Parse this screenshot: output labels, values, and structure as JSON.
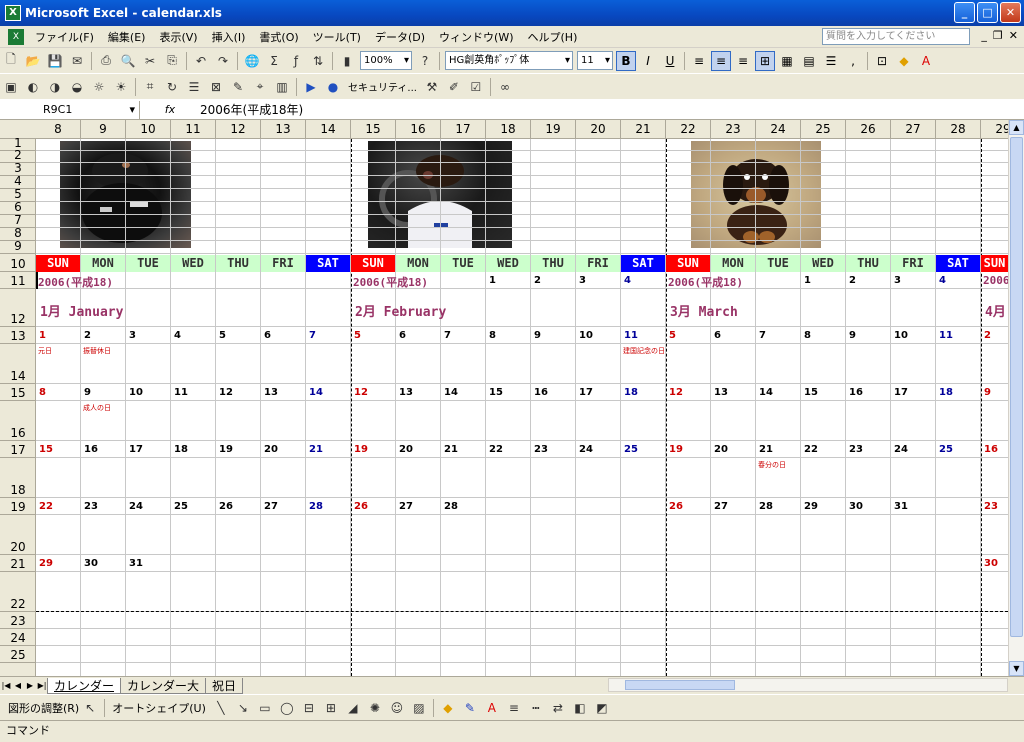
{
  "window": {
    "title": "Microsoft Excel - calendar.xls"
  },
  "menu": {
    "items": [
      "ファイル(F)",
      "編集(E)",
      "表示(V)",
      "挿入(I)",
      "書式(O)",
      "ツール(T)",
      "データ(D)",
      "ウィンドウ(W)",
      "ヘルプ(H)"
    ],
    "help_placeholder": "質問を入力してください"
  },
  "toolbar": {
    "zoom": "100%",
    "font": "HG創英角ﾎﾟｯﾌﾟ体",
    "size": "11",
    "security": "セキュリティ..."
  },
  "formula": {
    "cell": "R9C1",
    "fx": "fx",
    "value": "2006年(平成18年)"
  },
  "columns": [
    "8",
    "9",
    "10",
    "11",
    "12",
    "13",
    "14",
    "15",
    "16",
    "17",
    "18",
    "19",
    "20",
    "21",
    "22",
    "23",
    "24",
    "25",
    "26",
    "27",
    "28",
    "29"
  ],
  "rows": [
    "1",
    "2",
    "3",
    "4",
    "5",
    "6",
    "7",
    "8",
    "9",
    "10",
    "11",
    "12",
    "13",
    "14",
    "15",
    "16",
    "17",
    "18",
    "19",
    "20",
    "21",
    "22",
    "23",
    "24",
    "25"
  ],
  "dow": [
    "SUN",
    "MON",
    "TUE",
    "WED",
    "THU",
    "FRI",
    "SAT"
  ],
  "months": [
    {
      "year": "2006(平成18)",
      "title": "1月 January",
      "lead": [],
      "weeks": [
        [
          "1",
          "2",
          "3",
          "4",
          "5",
          "6",
          "7"
        ],
        [
          "8",
          "9",
          "10",
          "11",
          "12",
          "13",
          "14"
        ],
        [
          "15",
          "16",
          "17",
          "18",
          "19",
          "20",
          "21"
        ],
        [
          "22",
          "23",
          "24",
          "25",
          "26",
          "27",
          "28"
        ],
        [
          "29",
          "30",
          "31",
          "",
          "",
          "",
          ""
        ]
      ],
      "holidays": [
        {
          "w": 0,
          "d": 0,
          "t": "元日"
        },
        {
          "w": 0,
          "d": 1,
          "t": "振替休日"
        },
        {
          "w": 1,
          "d": 1,
          "t": "成人の日"
        }
      ]
    },
    {
      "year": "2006(平成18)",
      "title": "2月 February",
      "lead": [
        "",
        "",
        "",
        "1",
        "2",
        "3",
        "4"
      ],
      "weeks": [
        [
          "5",
          "6",
          "7",
          "8",
          "9",
          "10",
          "11"
        ],
        [
          "12",
          "13",
          "14",
          "15",
          "16",
          "17",
          "18"
        ],
        [
          "19",
          "20",
          "21",
          "22",
          "23",
          "24",
          "25"
        ],
        [
          "26",
          "27",
          "28",
          "",
          "",
          "",
          ""
        ],
        [
          "",
          "",
          "",
          "",
          "",
          "",
          ""
        ]
      ],
      "holidays": [
        {
          "w": 0,
          "d": 6,
          "t": "建国記念の日"
        }
      ]
    },
    {
      "year": "2006(平成18)",
      "title": "3月 March",
      "lead": [
        "",
        "",
        "",
        "1",
        "2",
        "3",
        "4"
      ],
      "weeks": [
        [
          "5",
          "6",
          "7",
          "8",
          "9",
          "10",
          "11"
        ],
        [
          "12",
          "13",
          "14",
          "15",
          "16",
          "17",
          "18"
        ],
        [
          "19",
          "20",
          "21",
          "22",
          "23",
          "24",
          "25"
        ],
        [
          "26",
          "27",
          "28",
          "29",
          "30",
          "31",
          ""
        ],
        [
          "",
          "",
          "",
          "",
          "",
          "",
          ""
        ]
      ],
      "holidays": [
        {
          "w": 2,
          "d": 2,
          "t": "春分の日"
        }
      ]
    }
  ],
  "next_month": {
    "year": "2006",
    "title": "4月",
    "weeks": [
      "2",
      "9",
      "16",
      "23",
      "30"
    ]
  },
  "sheets": [
    "カレンダー",
    "カレンダー大",
    "祝日"
  ],
  "drawing": {
    "adjust": "図形の調整(R)",
    "autoshape": "オートシェイプ(U)"
  },
  "status": "コマンド"
}
